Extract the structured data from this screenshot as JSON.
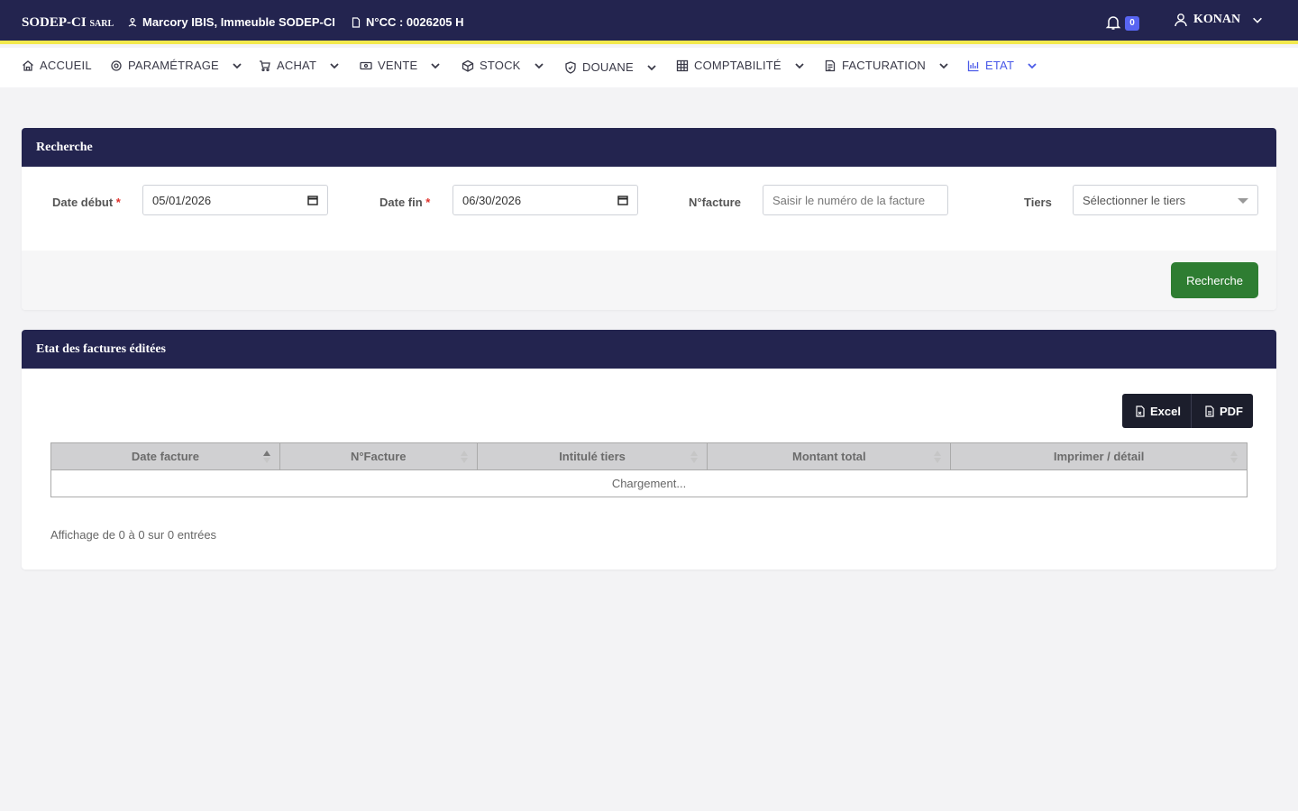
{
  "topbar": {
    "brand": "SODEP-CI",
    "brand_suffix": "SARL",
    "address": "Marcory IBIS, Immeuble SODEP-CI",
    "ncc": "N°CC : 0026205 H",
    "notifications": "0",
    "user": "KONAN"
  },
  "nav": {
    "items": [
      {
        "label": "ACCUEIL"
      },
      {
        "label": "PARAMÉTRAGE"
      },
      {
        "label": "ACHAT"
      },
      {
        "label": "VENTE"
      },
      {
        "label": "STOCK"
      },
      {
        "label": "DOUANE"
      },
      {
        "label": "COMPTABILITÉ"
      },
      {
        "label": "FACTURATION"
      },
      {
        "label": "ETAT"
      }
    ]
  },
  "search": {
    "title": "Recherche",
    "date_debut_label": "Date début",
    "date_debut_value": "05/01/2026",
    "date_fin_label": "Date fin",
    "date_fin_value": "06/30/2026",
    "nfacture_label": "N°facture",
    "nfacture_placeholder": "Saisir le numéro de la facture",
    "tiers_label": "Tiers",
    "tiers_placeholder": "Sélectionner le tiers",
    "required_mark": "*",
    "button": "Recherche"
  },
  "etat": {
    "title": "Etat des factures éditées",
    "excel": "Excel",
    "pdf": "PDF",
    "columns": [
      "Date facture",
      "N°Facture",
      "Intitulé tiers",
      "Montant total",
      "Imprimer / détail"
    ],
    "loading": "Chargement...",
    "info": "Affichage de 0 à 0 sur 0 entrées"
  },
  "colors": {
    "header_bg": "#23244f",
    "accent_yellow": "#f2e94e",
    "active_nav": "#4a5ae8",
    "search_button": "#2e7d32",
    "badge": "#5865f2"
  }
}
